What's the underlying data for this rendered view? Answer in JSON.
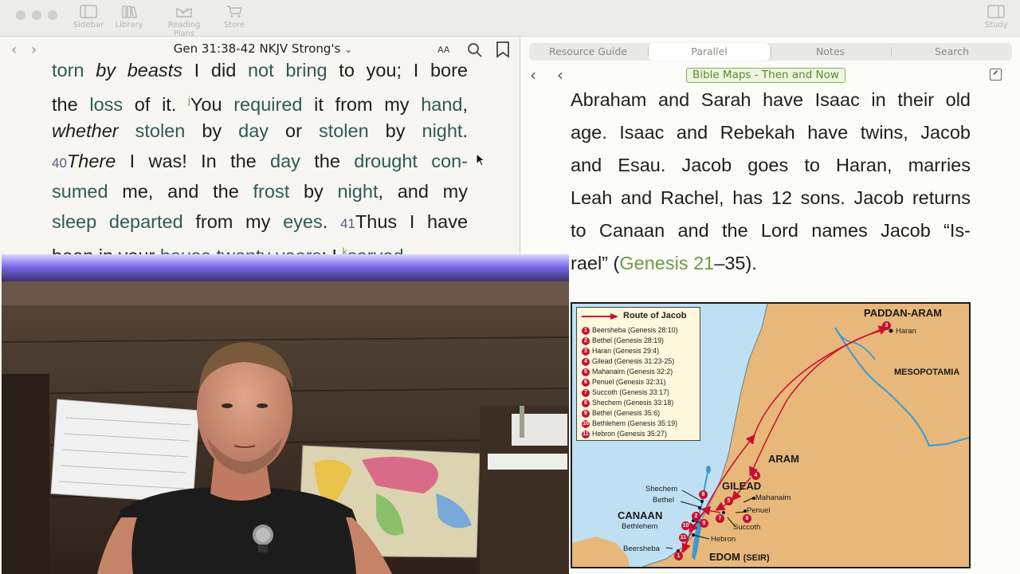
{
  "toolbar": {
    "buttons": [
      {
        "label": "Sidebar",
        "icon": "sidebar-icon"
      },
      {
        "label": "Library",
        "icon": "library-icon"
      },
      {
        "label": "Reading Plans",
        "icon": "reading-plans-icon"
      },
      {
        "label": "Store",
        "icon": "cart-icon"
      },
      {
        "label": "Study",
        "icon": "study-icon"
      }
    ]
  },
  "left": {
    "reference": "Gen 31:38-42",
    "version": "NKJV Strong's",
    "font_toggle": "AA",
    "lines": [
      {
        "parts": [
          {
            "t": "torn",
            "c": "sw"
          },
          {
            "t": " by beasts",
            "c": "it"
          },
          {
            "t": " I did "
          },
          {
            "t": "not",
            "c": "sw"
          },
          {
            "t": " "
          },
          {
            "t": "bring",
            "c": "sw"
          },
          {
            "t": " to you; I bore"
          }
        ]
      },
      {
        "parts": [
          {
            "t": "the "
          },
          {
            "t": "loss",
            "c": "sw"
          },
          {
            "t": " of it. "
          },
          {
            "t": "j",
            "c": "fn"
          },
          {
            "t": "You "
          },
          {
            "t": "required",
            "c": "sw"
          },
          {
            "t": " it from my "
          },
          {
            "t": "hand",
            "c": "sw"
          },
          {
            "t": ","
          }
        ]
      },
      {
        "parts": [
          {
            "t": "whether",
            "c": "it"
          },
          {
            "t": " "
          },
          {
            "t": "stolen",
            "c": "sw"
          },
          {
            "t": " by "
          },
          {
            "t": "day",
            "c": "sw"
          },
          {
            "t": " or "
          },
          {
            "t": "stolen",
            "c": "sw"
          },
          {
            "t": " by "
          },
          {
            "t": "night",
            "c": "sw"
          },
          {
            "t": "."
          }
        ]
      },
      {
        "parts": [
          {
            "t": "40",
            "c": "vn"
          },
          {
            "t": "There",
            "c": "it"
          },
          {
            "t": " I was! In the "
          },
          {
            "t": "day",
            "c": "sw"
          },
          {
            "t": " the "
          },
          {
            "t": "drought",
            "c": "sw"
          },
          {
            "t": " "
          },
          {
            "t": "con-",
            "c": "sw"
          }
        ]
      },
      {
        "parts": [
          {
            "t": "sumed",
            "c": "sw"
          },
          {
            "t": " me, and the "
          },
          {
            "t": "frost",
            "c": "sw"
          },
          {
            "t": " by "
          },
          {
            "t": "night",
            "c": "sw"
          },
          {
            "t": ", and my"
          }
        ]
      },
      {
        "parts": [
          {
            "t": "sleep",
            "c": "sw"
          },
          {
            "t": " "
          },
          {
            "t": "departed",
            "c": "sw"
          },
          {
            "t": " from my "
          },
          {
            "t": "eyes",
            "c": "sw"
          },
          {
            "t": ". "
          },
          {
            "t": "41",
            "c": "vn"
          },
          {
            "t": "Thus I have"
          }
        ]
      },
      {
        "parts": [
          {
            "t": "been in your "
          },
          {
            "t": "house",
            "c": "sw"
          },
          {
            "t": " "
          },
          {
            "t": "twenty",
            "c": "sw"
          },
          {
            "t": " "
          },
          {
            "t": "years",
            "c": "sw"
          },
          {
            "t": "; I "
          },
          {
            "t": "k",
            "c": "fn"
          },
          {
            "t": "served",
            "c": "sw"
          }
        ]
      }
    ]
  },
  "right": {
    "tabs": [
      "Resource Guide",
      "Parallel",
      "Notes",
      "Search"
    ],
    "active_tab": 1,
    "resource": "Bible Maps - Then and Now",
    "lines": [
      {
        "parts": [
          {
            "t": "Abraham and Sarah have Isaac in their old"
          }
        ]
      },
      {
        "parts": [
          {
            "t": "age. Isaac and Rebekah have twins, Jacob"
          }
        ]
      },
      {
        "parts": [
          {
            "t": "and Esau. Jacob goes to Haran, marries"
          }
        ]
      },
      {
        "parts": [
          {
            "t": "Leah and Rachel, has 12 sons. Jacob returns"
          }
        ]
      },
      {
        "parts": [
          {
            "t": "to Canaan and the Lord names Jacob “Is-"
          }
        ]
      },
      {
        "parts": [
          {
            "t": "rael” ("
          },
          {
            "t": "Genesis 21",
            "c": "gref"
          },
          {
            "t": "–35)."
          }
        ]
      }
    ]
  },
  "map": {
    "legend_title": "Route of Jacob",
    "legend": [
      "Beersheba (Genesis 28:10)",
      "Bethel (Genesis 28:19)",
      "Haran (Genesis 29:4)",
      "Gilead (Genesis 31:23-25)",
      "Mahanaim (Genesis 32:2)",
      "Penuel (Genesis 32:31)",
      "Succoth (Genesis 33:17)",
      "Shechem (Genesis 33:18)",
      "Bethel (Genesis 35:6)",
      "Bethlehem (Genesis 35:19)",
      "Hebron (Genesis 35:27)"
    ],
    "regions": {
      "paddan": "PADDAN-ARAM",
      "meso": "MESOPOTAMIA",
      "aram": "ARAM",
      "gilead": "GILEAD",
      "canaan": "CANAAN",
      "edom": "EDOM",
      "seir": "(SEIR)"
    },
    "towns": {
      "haran": "Haran",
      "shechem": "Shechem",
      "bethel": "Bethel",
      "mahanaim": "Mahanaim",
      "penuel": "Penuel",
      "succoth": "Succoth",
      "bethlehem": "Bethlehem",
      "hebron": "Hebron",
      "beersheba": "Beersheba"
    },
    "colors": {
      "land": "#e7b87a",
      "sea": "#bfe0f3",
      "route": "#c8102e",
      "river": "#3b9ad8"
    }
  }
}
